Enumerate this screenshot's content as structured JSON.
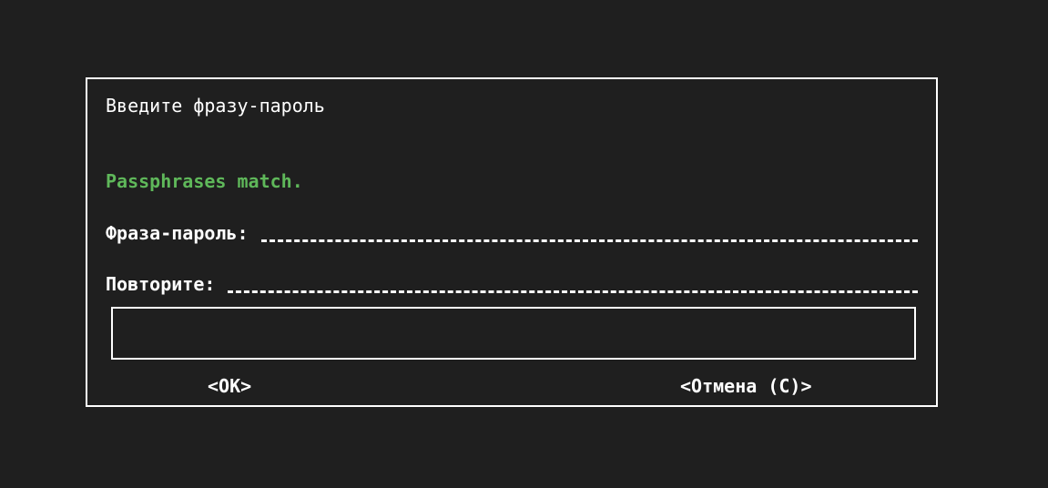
{
  "dialog": {
    "title": "Введите фразу-пароль",
    "status_message": "Passphrases match.",
    "status_color": "#5fb85a",
    "fields": [
      {
        "label": "Фраза-пароль:",
        "value": ""
      },
      {
        "label": "Повторите:",
        "value": ""
      }
    ],
    "message_box_text": "",
    "buttons": {
      "ok_label": "<OK>",
      "cancel_label": "<Отмена (C)>"
    }
  }
}
